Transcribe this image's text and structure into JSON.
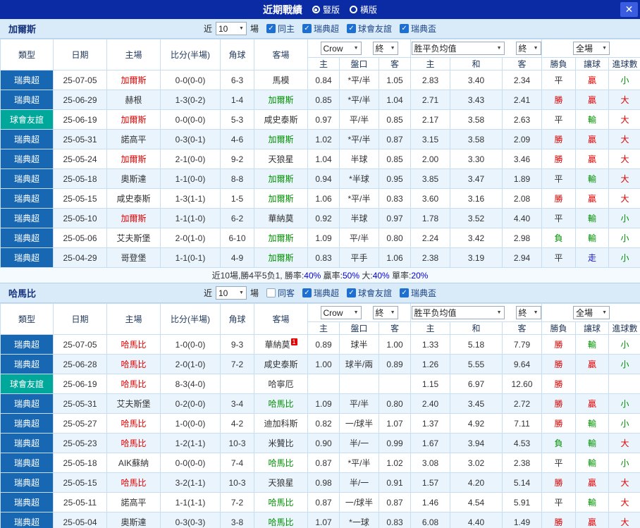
{
  "topbar": {
    "title": "近期戰績",
    "radios": [
      {
        "label": "豎版",
        "selected": true
      },
      {
        "label": "橫版",
        "selected": false
      }
    ]
  },
  "icons": {
    "close": "✕",
    "dropdown": "▼",
    "check": "✓"
  },
  "headers": {
    "type": "類型",
    "date": "日期",
    "home": "主場",
    "score": "比分(半場)",
    "corner": "角球",
    "away": "客場",
    "h": "主",
    "line": "盤口",
    "a": "客",
    "eu_h": "主",
    "eu_d": "和",
    "eu_a": "客",
    "res": "勝負",
    "hcp": "讓球",
    "goals": "進球數"
  },
  "selects": {
    "company": "Crow",
    "final1": "終",
    "europe": "胜平负均值",
    "final2": "終",
    "scope": "全場"
  },
  "sections": [
    {
      "team": "加爾斯",
      "near_prefix": "近",
      "near_count": "10",
      "near_suffix": "場",
      "filters": [
        {
          "label": "同主",
          "checked": true
        },
        {
          "label": "瑞典超",
          "checked": true
        },
        {
          "label": "球會友誼",
          "checked": true
        },
        {
          "label": "瑞典盃",
          "checked": true
        }
      ],
      "rows": [
        {
          "lg": "瑞典超",
          "lgs": "blue",
          "date": "25-07-05",
          "home": "加爾斯",
          "hs": "red",
          "score": "0-0(0-0)",
          "cn": "6-3",
          "away": "馬模",
          "as": "dark",
          "ah": "0.84",
          "ln": "*平/半",
          "aa": "1.05",
          "eh": "2.83",
          "ed": "3.40",
          "ea": "2.34",
          "r": "平",
          "rs": "dark",
          "hc": "贏",
          "hcs": "red",
          "sz": "小",
          "szs": "green"
        },
        {
          "lg": "瑞典超",
          "lgs": "blue",
          "date": "25-06-29",
          "home": "赫根",
          "hs": "dark",
          "score": "1-3(0-2)",
          "cn": "1-4",
          "away": "加爾斯",
          "as": "green",
          "ah": "0.85",
          "ln": "*平/半",
          "aa": "1.04",
          "eh": "2.71",
          "ed": "3.43",
          "ea": "2.41",
          "r": "勝",
          "rs": "red",
          "hc": "贏",
          "hcs": "red",
          "sz": "大",
          "szs": "red"
        },
        {
          "lg": "球會友誼",
          "lgs": "teal",
          "date": "25-06-19",
          "home": "加爾斯",
          "hs": "red",
          "score": "0-0(0-0)",
          "cn": "5-3",
          "away": "咸史泰斯",
          "as": "dark",
          "ah": "0.97",
          "ln": "平/半",
          "aa": "0.85",
          "eh": "2.17",
          "ed": "3.58",
          "ea": "2.63",
          "r": "平",
          "rs": "dark",
          "hc": "輸",
          "hcs": "green",
          "sz": "大",
          "szs": "red"
        },
        {
          "lg": "瑞典超",
          "lgs": "blue",
          "date": "25-05-31",
          "home": "諾高平",
          "hs": "dark",
          "score": "0-3(0-1)",
          "cn": "4-6",
          "away": "加爾斯",
          "as": "green",
          "ah": "1.02",
          "ln": "*平/半",
          "aa": "0.87",
          "eh": "3.15",
          "ed": "3.58",
          "ea": "2.09",
          "r": "勝",
          "rs": "red",
          "hc": "贏",
          "hcs": "red",
          "sz": "大",
          "szs": "red"
        },
        {
          "lg": "瑞典超",
          "lgs": "blue",
          "date": "25-05-24",
          "home": "加爾斯",
          "hs": "red",
          "score": "2-1(0-0)",
          "cn": "9-2",
          "away": "天狼星",
          "as": "dark",
          "ah": "1.04",
          "ln": "半球",
          "aa": "0.85",
          "eh": "2.00",
          "ed": "3.30",
          "ea": "3.46",
          "r": "勝",
          "rs": "red",
          "hc": "贏",
          "hcs": "red",
          "sz": "大",
          "szs": "red"
        },
        {
          "lg": "瑞典超",
          "lgs": "blue",
          "date": "25-05-18",
          "home": "奧斯達",
          "hs": "dark",
          "score": "1-1(0-0)",
          "cn": "8-8",
          "away": "加爾斯",
          "as": "green",
          "ah": "0.94",
          "ln": "*半球",
          "aa": "0.95",
          "eh": "3.85",
          "ed": "3.47",
          "ea": "1.89",
          "r": "平",
          "rs": "dark",
          "hc": "輸",
          "hcs": "green",
          "sz": "大",
          "szs": "red"
        },
        {
          "lg": "瑞典超",
          "lgs": "blue",
          "date": "25-05-15",
          "home": "咸史泰斯",
          "hs": "dark",
          "score": "1-3(1-1)",
          "cn": "1-5",
          "away": "加爾斯",
          "as": "green",
          "ah": "1.06",
          "ln": "*平/半",
          "aa": "0.83",
          "eh": "3.60",
          "ed": "3.16",
          "ea": "2.08",
          "r": "勝",
          "rs": "red",
          "hc": "贏",
          "hcs": "red",
          "sz": "大",
          "szs": "red"
        },
        {
          "lg": "瑞典超",
          "lgs": "blue",
          "date": "25-05-10",
          "home": "加爾斯",
          "hs": "red",
          "score": "1-1(1-0)",
          "cn": "6-2",
          "away": "華納莫",
          "as": "dark",
          "ah": "0.92",
          "ln": "半球",
          "aa": "0.97",
          "eh": "1.78",
          "ed": "3.52",
          "ea": "4.40",
          "r": "平",
          "rs": "dark",
          "hc": "輸",
          "hcs": "green",
          "sz": "小",
          "szs": "green"
        },
        {
          "lg": "瑞典超",
          "lgs": "blue",
          "date": "25-05-06",
          "home": "艾夫斯堡",
          "hs": "dark",
          "score": "2-0(1-0)",
          "cn": "6-10",
          "away": "加爾斯",
          "as": "green",
          "ah": "1.09",
          "ln": "平/半",
          "aa": "0.80",
          "eh": "2.24",
          "ed": "3.42",
          "ea": "2.98",
          "r": "負",
          "rs": "green",
          "hc": "輸",
          "hcs": "green",
          "sz": "小",
          "szs": "green"
        },
        {
          "lg": "瑞典超",
          "lgs": "blue",
          "date": "25-04-29",
          "home": "哥登堡",
          "hs": "dark",
          "score": "1-1(0-1)",
          "cn": "4-9",
          "away": "加爾斯",
          "as": "green",
          "ah": "0.83",
          "ln": "平手",
          "aa": "1.06",
          "eh": "2.38",
          "ed": "3.19",
          "ea": "2.94",
          "r": "平",
          "rs": "dark",
          "hc": "走",
          "hcs": "blue",
          "sz": "小",
          "szs": "green"
        }
      ],
      "summary": [
        {
          "t": "近10場,勝4平5负1, 勝率:",
          "s": "dark"
        },
        {
          "t": "40%",
          "s": "blue"
        },
        {
          "t": " 贏率:",
          "s": "dark"
        },
        {
          "t": "50%",
          "s": "blue"
        },
        {
          "t": " 大:",
          "s": "dark"
        },
        {
          "t": "40%",
          "s": "blue"
        },
        {
          "t": " 單率:",
          "s": "dark"
        },
        {
          "t": "20%",
          "s": "blue"
        }
      ]
    },
    {
      "team": "哈馬比",
      "near_prefix": "近",
      "near_count": "10",
      "near_suffix": "場",
      "filters": [
        {
          "label": "同客",
          "checked": false
        },
        {
          "label": "瑞典超",
          "checked": true
        },
        {
          "label": "球會友誼",
          "checked": true
        },
        {
          "label": "瑞典盃",
          "checked": true
        }
      ],
      "rows": [
        {
          "lg": "瑞典超",
          "lgs": "blue",
          "date": "25-07-05",
          "home": "哈馬比",
          "hs": "red",
          "score": "1-0(0-0)",
          "cn": "9-3",
          "away": "華納莫",
          "as": "dark",
          "sup": "1",
          "ah": "0.89",
          "ln": "球半",
          "aa": "1.00",
          "eh": "1.33",
          "ed": "5.18",
          "ea": "7.79",
          "r": "勝",
          "rs": "red",
          "hc": "輸",
          "hcs": "green",
          "sz": "小",
          "szs": "green"
        },
        {
          "lg": "瑞典超",
          "lgs": "blue",
          "date": "25-06-28",
          "home": "哈馬比",
          "hs": "red",
          "score": "2-0(1-0)",
          "cn": "7-2",
          "away": "咸史泰斯",
          "as": "dark",
          "ah": "1.00",
          "ln": "球半/兩",
          "aa": "0.89",
          "eh": "1.26",
          "ed": "5.55",
          "ea": "9.64",
          "r": "勝",
          "rs": "red",
          "hc": "贏",
          "hcs": "red",
          "sz": "小",
          "szs": "green"
        },
        {
          "lg": "球會友誼",
          "lgs": "teal",
          "date": "25-06-19",
          "home": "哈馬比",
          "hs": "red",
          "score": "8-3(4-0)",
          "cn": "",
          "away": "哈寧厄",
          "as": "dark",
          "ah": "",
          "ln": "",
          "aa": "",
          "eh": "1.15",
          "ed": "6.97",
          "ea": "12.60",
          "r": "勝",
          "rs": "red",
          "hc": "",
          "hcs": "dark",
          "sz": "",
          "szs": "dark"
        },
        {
          "lg": "瑞典超",
          "lgs": "blue",
          "date": "25-05-31",
          "home": "艾夫斯堡",
          "hs": "dark",
          "score": "0-2(0-0)",
          "cn": "3-4",
          "away": "哈馬比",
          "as": "green",
          "ah": "1.09",
          "ln": "平/半",
          "aa": "0.80",
          "eh": "2.40",
          "ed": "3.45",
          "ea": "2.72",
          "r": "勝",
          "rs": "red",
          "hc": "贏",
          "hcs": "red",
          "sz": "小",
          "szs": "green"
        },
        {
          "lg": "瑞典超",
          "lgs": "blue",
          "date": "25-05-27",
          "home": "哈馬比",
          "hs": "red",
          "score": "1-0(0-0)",
          "cn": "4-2",
          "away": "迪加科斯",
          "as": "dark",
          "ah": "0.82",
          "ln": "一/球半",
          "aa": "1.07",
          "eh": "1.37",
          "ed": "4.92",
          "ea": "7.11",
          "r": "勝",
          "rs": "red",
          "hc": "輸",
          "hcs": "green",
          "sz": "小",
          "szs": "green"
        },
        {
          "lg": "瑞典超",
          "lgs": "blue",
          "date": "25-05-23",
          "home": "哈馬比",
          "hs": "red",
          "score": "1-2(1-1)",
          "cn": "10-3",
          "away": "米贊比",
          "as": "dark",
          "ah": "0.90",
          "ln": "半/一",
          "aa": "0.99",
          "eh": "1.67",
          "ed": "3.94",
          "ea": "4.53",
          "r": "負",
          "rs": "green",
          "hc": "輸",
          "hcs": "green",
          "sz": "大",
          "szs": "red"
        },
        {
          "lg": "瑞典超",
          "lgs": "blue",
          "date": "25-05-18",
          "home": "AIK蘇納",
          "hs": "dark",
          "score": "0-0(0-0)",
          "cn": "7-4",
          "away": "哈馬比",
          "as": "green",
          "ah": "0.87",
          "ln": "*平/半",
          "aa": "1.02",
          "eh": "3.08",
          "ed": "3.02",
          "ea": "2.38",
          "r": "平",
          "rs": "dark",
          "hc": "輸",
          "hcs": "green",
          "sz": "小",
          "szs": "green"
        },
        {
          "lg": "瑞典超",
          "lgs": "blue",
          "date": "25-05-15",
          "home": "哈馬比",
          "hs": "red",
          "score": "3-2(1-1)",
          "cn": "10-3",
          "away": "天狼星",
          "as": "dark",
          "ah": "0.98",
          "ln": "半/一",
          "aa": "0.91",
          "eh": "1.57",
          "ed": "4.20",
          "ea": "5.14",
          "r": "勝",
          "rs": "red",
          "hc": "贏",
          "hcs": "red",
          "sz": "大",
          "szs": "red"
        },
        {
          "lg": "瑞典超",
          "lgs": "blue",
          "date": "25-05-11",
          "home": "諾高平",
          "hs": "dark",
          "score": "1-1(1-1)",
          "cn": "7-2",
          "away": "哈馬比",
          "as": "green",
          "ah": "0.87",
          "ln": "一/球半",
          "aa": "0.87",
          "eh": "1.46",
          "ed": "4.54",
          "ea": "5.91",
          "r": "平",
          "rs": "dark",
          "hc": "輸",
          "hcs": "green",
          "sz": "大",
          "szs": "red"
        },
        {
          "lg": "瑞典超",
          "lgs": "blue",
          "date": "25-05-04",
          "home": "奧斯達",
          "hs": "dark",
          "score": "0-3(0-3)",
          "cn": "3-8",
          "away": "哈馬比",
          "as": "green",
          "ah": "1.07",
          "ln": "*一球",
          "aa": "0.83",
          "eh": "6.08",
          "ed": "4.40",
          "ea": "1.49",
          "r": "勝",
          "rs": "red",
          "hc": "贏",
          "hcs": "red",
          "sz": "大",
          "szs": "red"
        }
      ]
    }
  ]
}
